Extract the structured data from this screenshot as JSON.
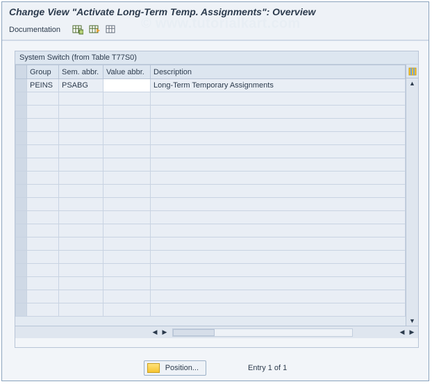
{
  "window": {
    "title": "Change View \"Activate Long-Term Temp. Assignments\": Overview"
  },
  "toolbar": {
    "documentation_label": "Documentation"
  },
  "panel": {
    "title": "System Switch (from Table T77S0)"
  },
  "columns": {
    "group": "Group",
    "sem_abbr": "Sem. abbr.",
    "value_abbr": "Value abbr.",
    "description": "Description"
  },
  "rows": [
    {
      "group": "PEINS",
      "sem": "PSABG",
      "val": "",
      "desc": "Long-Term Temporary Assignments"
    },
    {
      "group": "",
      "sem": "",
      "val": "",
      "desc": ""
    },
    {
      "group": "",
      "sem": "",
      "val": "",
      "desc": ""
    },
    {
      "group": "",
      "sem": "",
      "val": "",
      "desc": ""
    },
    {
      "group": "",
      "sem": "",
      "val": "",
      "desc": ""
    },
    {
      "group": "",
      "sem": "",
      "val": "",
      "desc": ""
    },
    {
      "group": "",
      "sem": "",
      "val": "",
      "desc": ""
    },
    {
      "group": "",
      "sem": "",
      "val": "",
      "desc": ""
    },
    {
      "group": "",
      "sem": "",
      "val": "",
      "desc": ""
    },
    {
      "group": "",
      "sem": "",
      "val": "",
      "desc": ""
    },
    {
      "group": "",
      "sem": "",
      "val": "",
      "desc": ""
    },
    {
      "group": "",
      "sem": "",
      "val": "",
      "desc": ""
    },
    {
      "group": "",
      "sem": "",
      "val": "",
      "desc": ""
    },
    {
      "group": "",
      "sem": "",
      "val": "",
      "desc": ""
    },
    {
      "group": "",
      "sem": "",
      "val": "",
      "desc": ""
    },
    {
      "group": "",
      "sem": "",
      "val": "",
      "desc": ""
    },
    {
      "group": "",
      "sem": "",
      "val": "",
      "desc": ""
    },
    {
      "group": "",
      "sem": "",
      "val": "",
      "desc": ""
    }
  ],
  "footer": {
    "position_button": "Position...",
    "entry_text": "Entry 1 of 1"
  },
  "watermark": "© www.tutorialkart.com"
}
